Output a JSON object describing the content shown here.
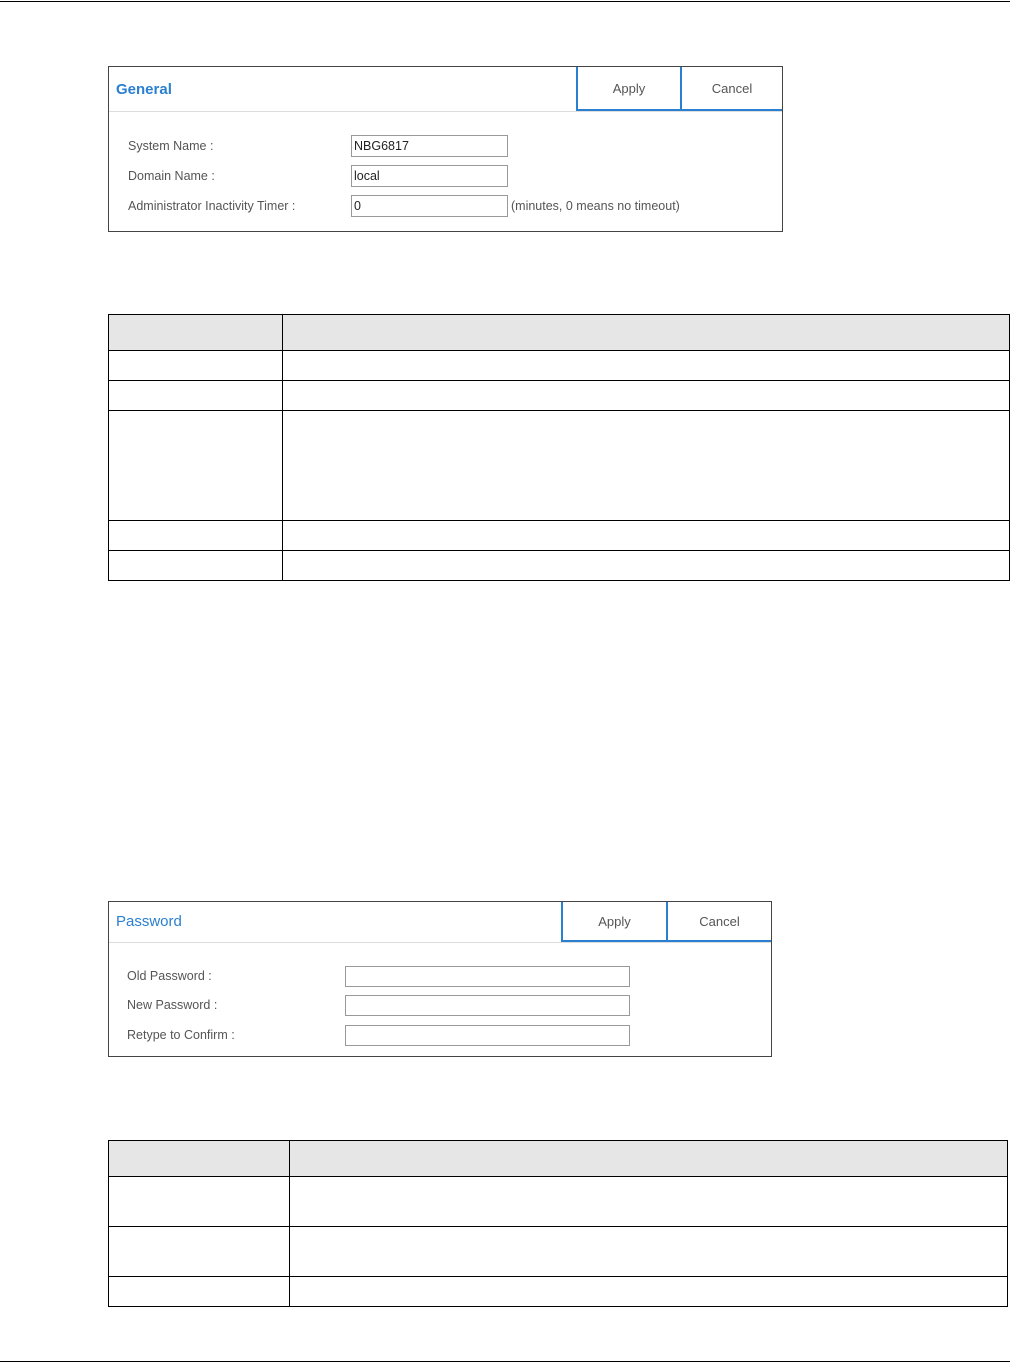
{
  "general_panel": {
    "title": "General",
    "apply_label": "Apply",
    "cancel_label": "Cancel",
    "fields": [
      {
        "label": "System Name :",
        "value": "NBG6817"
      },
      {
        "label": "Domain Name :",
        "value": "local"
      },
      {
        "label": "Administrator Inactivity Timer :",
        "value": "0"
      }
    ],
    "timer_hint": "(minutes, 0 means no timeout)"
  },
  "password_panel": {
    "title": "Password",
    "apply_label": "Apply",
    "cancel_label": "Cancel",
    "fields": [
      {
        "label": "Old Password :",
        "value": ""
      },
      {
        "label": "New Password :",
        "value": ""
      },
      {
        "label": "Retype to Confirm :",
        "value": ""
      }
    ]
  }
}
